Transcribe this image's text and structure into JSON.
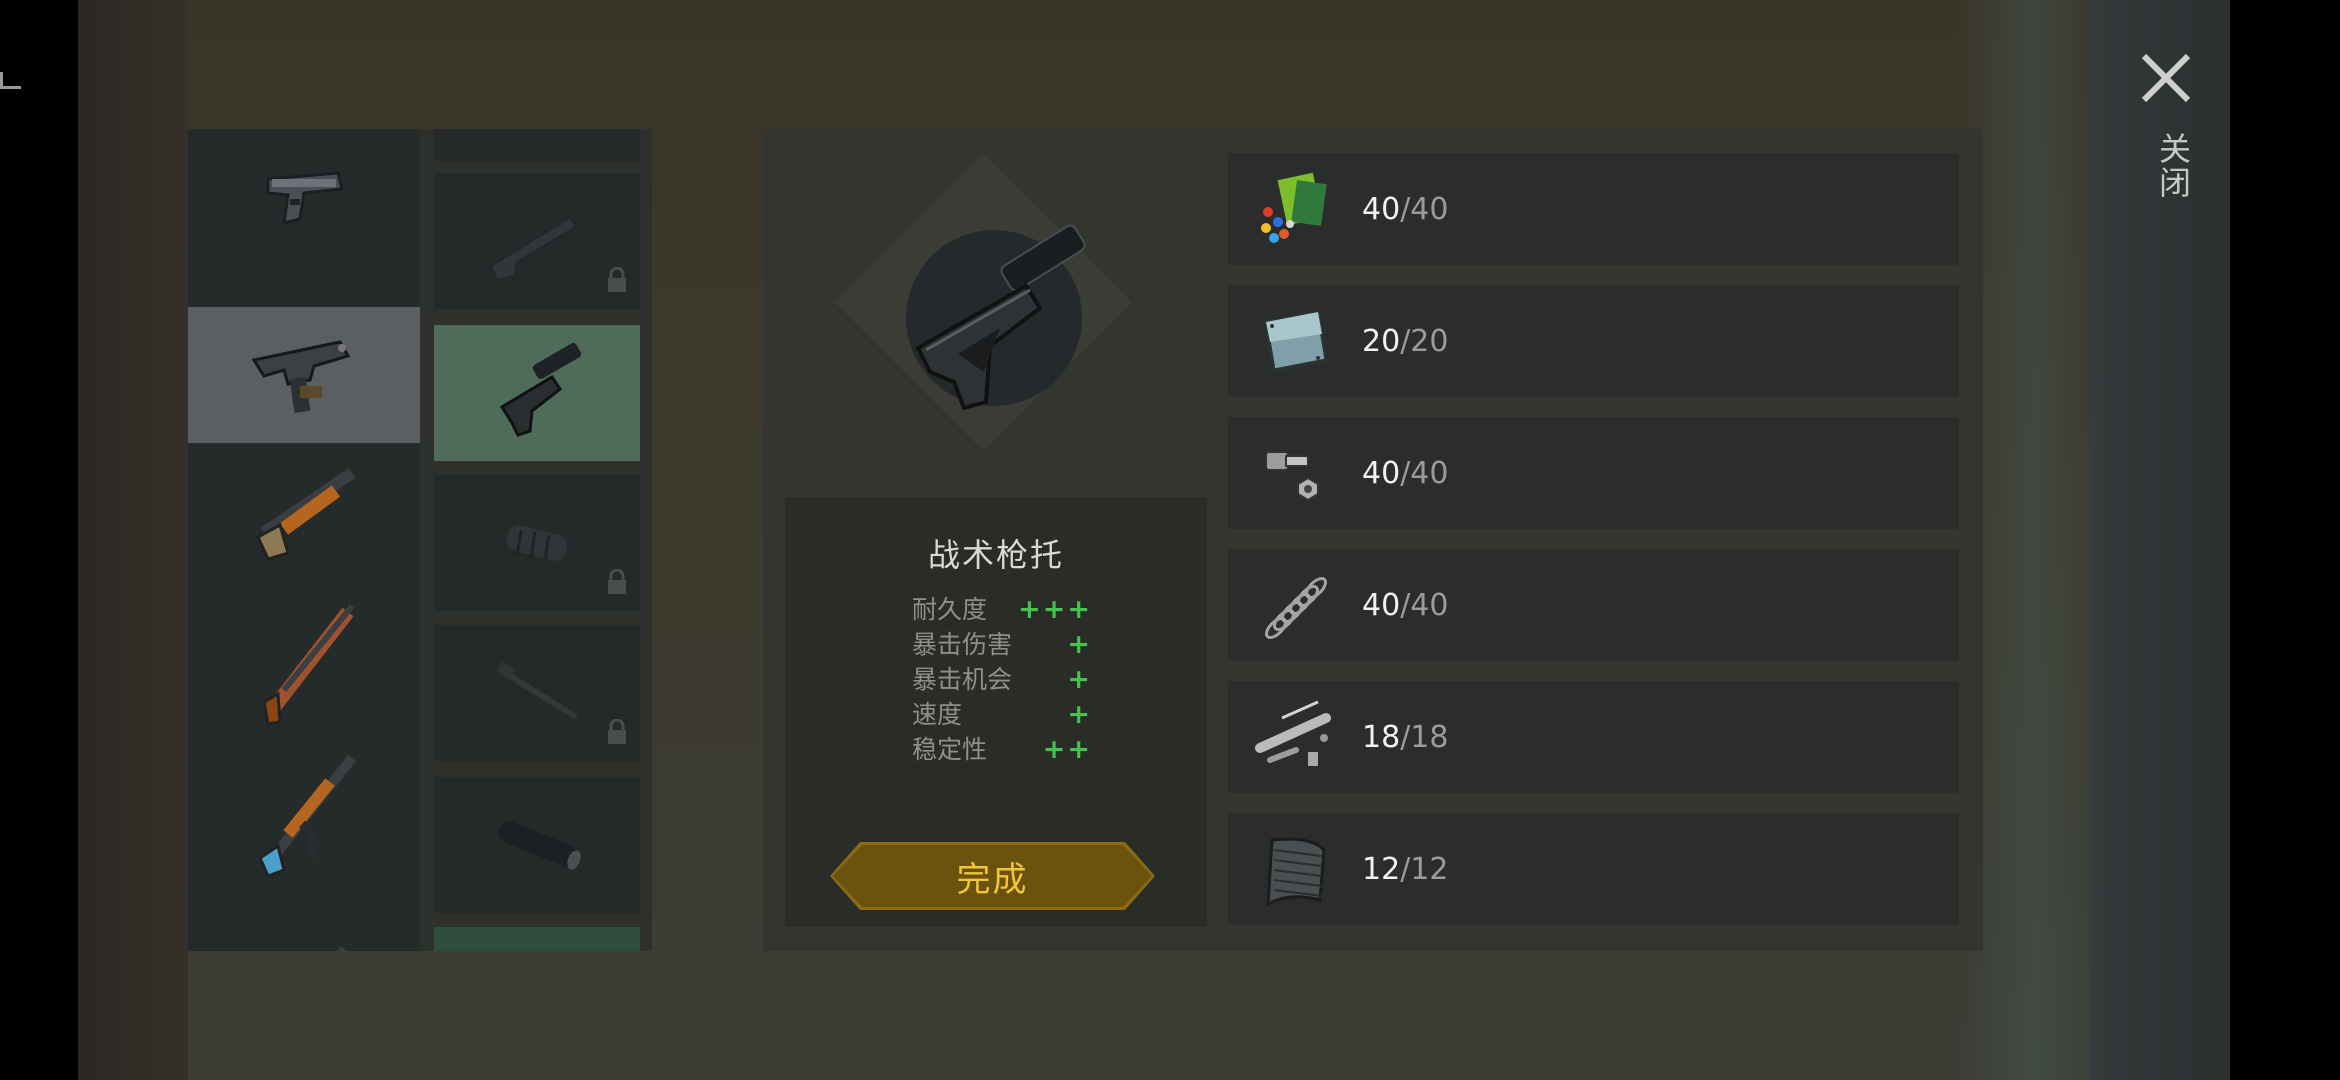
{
  "item": {
    "name": "战术枪托",
    "stats": [
      {
        "label": "耐久度",
        "value": "+++"
      },
      {
        "label": "暴击伤害",
        "value": "+"
      },
      {
        "label": "暴击机会",
        "value": "+"
      },
      {
        "label": "速度",
        "value": "+"
      },
      {
        "label": "稳定性",
        "value": "++"
      }
    ]
  },
  "done_button": {
    "label": "完成"
  },
  "close": {
    "label": "关闭"
  },
  "materials": [
    {
      "icon": "colorful-parts-icon",
      "have": "40",
      "need": "/40"
    },
    {
      "icon": "metal-plate-icon",
      "have": "20",
      "need": "/20"
    },
    {
      "icon": "bolt-nut-icon",
      "have": "40",
      "need": "/40"
    },
    {
      "icon": "spring-icon",
      "have": "40",
      "need": "/40"
    },
    {
      "icon": "gun-parts-icon",
      "have": "18",
      "need": "/18"
    },
    {
      "icon": "mesh-sheet-icon",
      "have": "12",
      "need": "/12"
    }
  ],
  "weapons": [
    {
      "name": "pistol-icon"
    },
    {
      "name": "uzi-icon",
      "selected": true
    },
    {
      "name": "shotgun-icon"
    },
    {
      "name": "rifle-icon"
    },
    {
      "name": "ak-rifle-icon"
    }
  ],
  "attachments": [
    {
      "name": "folding-stock-icon",
      "locked": true
    },
    {
      "name": "tactical-stock-icon",
      "selected": true
    },
    {
      "name": "grip-icon",
      "locked": true
    },
    {
      "name": "rod-icon",
      "locked": true
    },
    {
      "name": "silencer-icon",
      "locked": false
    }
  ],
  "colors": {
    "accent_green": "#45c34f",
    "button_gold": "#f0c63a",
    "selected_slot": "#4f6b5a"
  }
}
